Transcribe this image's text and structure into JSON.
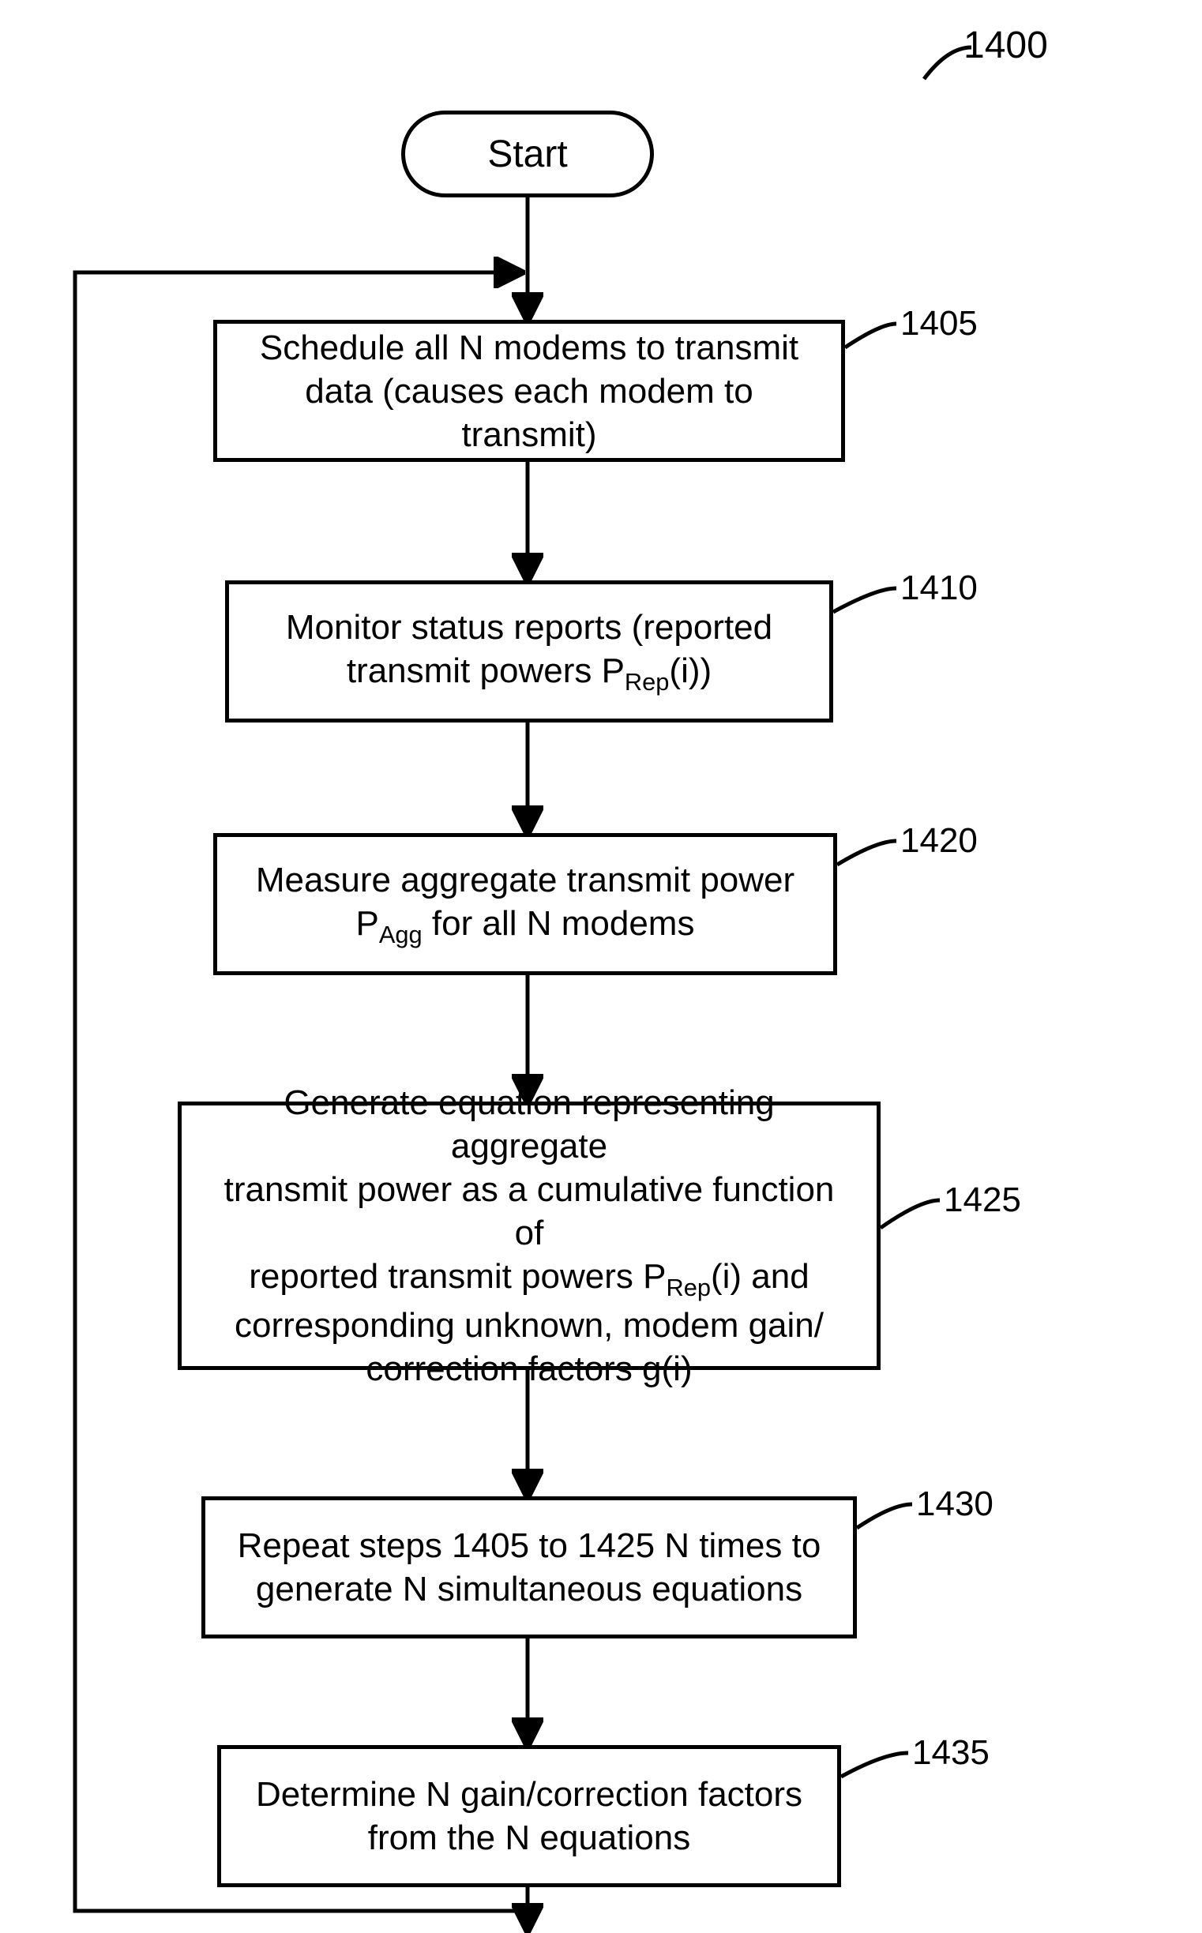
{
  "figure": {
    "label": "1400"
  },
  "nodes": {
    "start": {
      "text": "Start"
    },
    "s1405": {
      "ref": "1405",
      "text": "Schedule all N modems to transmit data (causes each modem to transmit)"
    },
    "s1410": {
      "ref": "1410",
      "line1": "Monitor status reports (reported",
      "line2_pre": "transmit powers P",
      "line2_sub": "Rep",
      "line2_post": "(i))"
    },
    "s1420": {
      "ref": "1420",
      "line1": "Measure aggregate transmit power",
      "line2_pre": "P",
      "line2_sub": "Agg",
      "line2_post": " for all N modems"
    },
    "s1425": {
      "ref": "1425",
      "line1": "Generate equation representing aggregate",
      "line2": "transmit power as a cumulative function of",
      "line3_pre": "reported transmit powers P",
      "line3_sub": "Rep",
      "line3_post": "(i) and",
      "line4": "corresponding unknown, modem gain/",
      "line5": "correction factors g(i)"
    },
    "s1430": {
      "ref": "1430",
      "text": "Repeat steps 1405 to 1425 N times to generate N simultaneous equations"
    },
    "s1435": {
      "ref": "1435",
      "text": "Determine N gain/correction factors from the N equations"
    }
  }
}
